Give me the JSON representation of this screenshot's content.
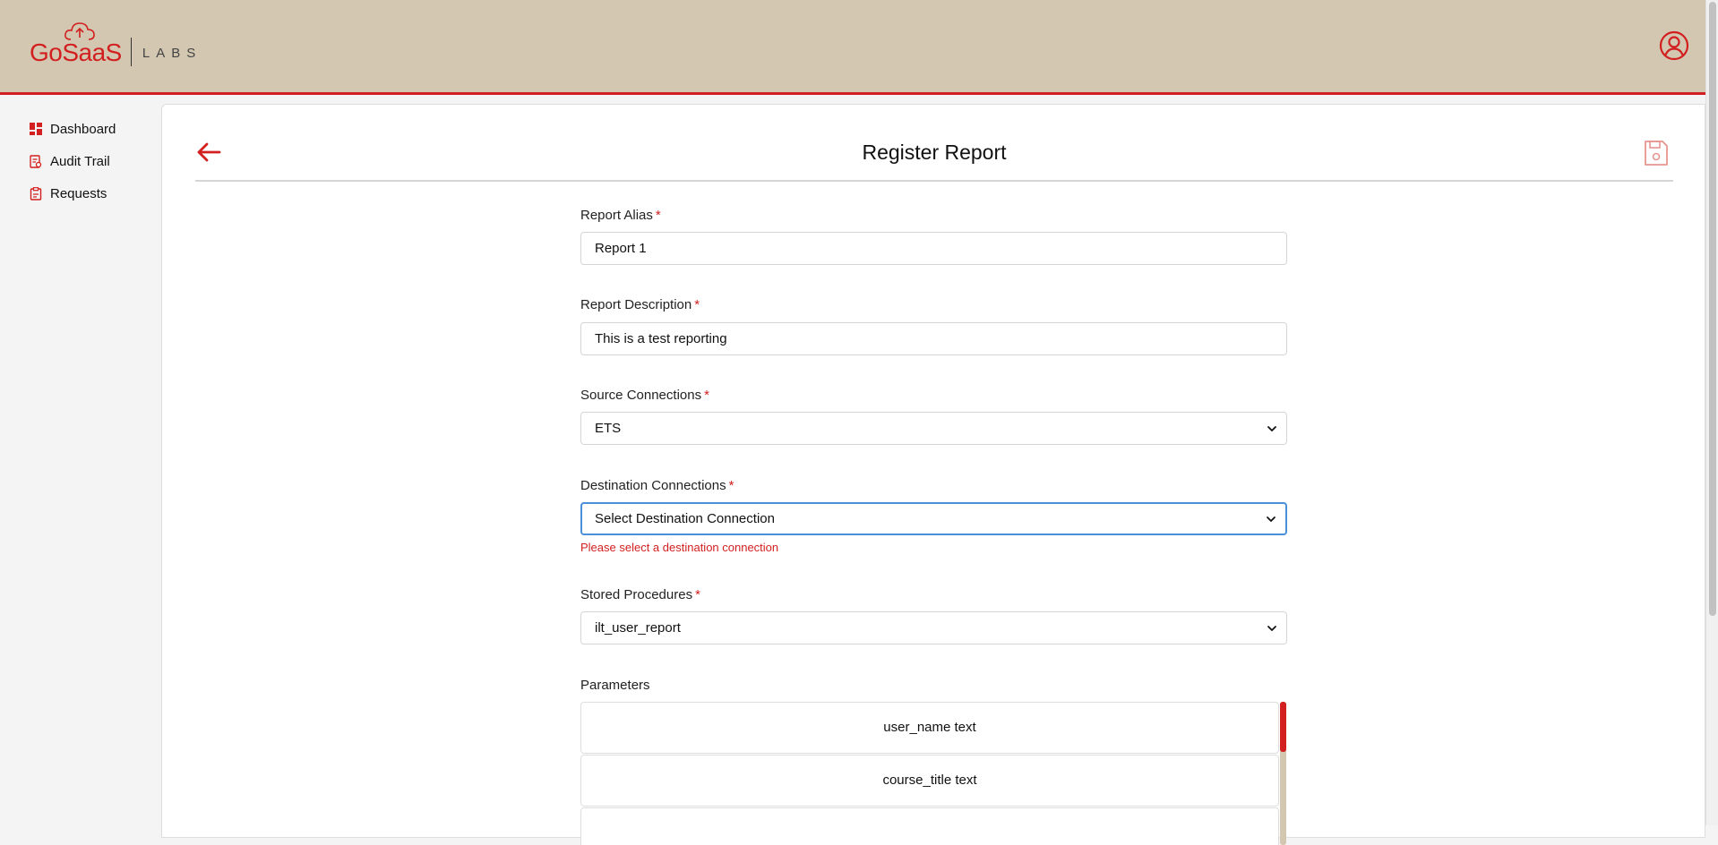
{
  "brand": {
    "name": "GoSaaS",
    "suffix": "LABS",
    "color": "#d21f1f"
  },
  "header": {
    "user_icon": "user-circle-icon",
    "background": "#d3c7b1"
  },
  "sidebar": {
    "items": [
      {
        "label": "Dashboard",
        "icon": "dashboard-icon"
      },
      {
        "label": "Audit Trail",
        "icon": "audit-trail-icon"
      },
      {
        "label": "Requests",
        "icon": "clipboard-icon"
      }
    ]
  },
  "page": {
    "title": "Register Report",
    "back_icon": "arrow-left-icon",
    "save_icon": "save-icon"
  },
  "form": {
    "report_alias": {
      "label": "Report Alias",
      "required": "*",
      "value": "Report 1"
    },
    "report_description": {
      "label": "Report Description",
      "required": "*",
      "value": "This is a test reporting"
    },
    "source_connections": {
      "label": "Source Connections",
      "required": "*",
      "value": "ETS"
    },
    "destination_connections": {
      "label": "Destination Connections",
      "required": "*",
      "value": "Select Destination Connection",
      "error": "Please select a destination connection"
    },
    "stored_procedures": {
      "label": "Stored Procedures",
      "required": "*",
      "value": "ilt_user_report"
    },
    "parameters": {
      "label": "Parameters",
      "items": [
        "user_name text",
        "course_title text"
      ]
    }
  }
}
